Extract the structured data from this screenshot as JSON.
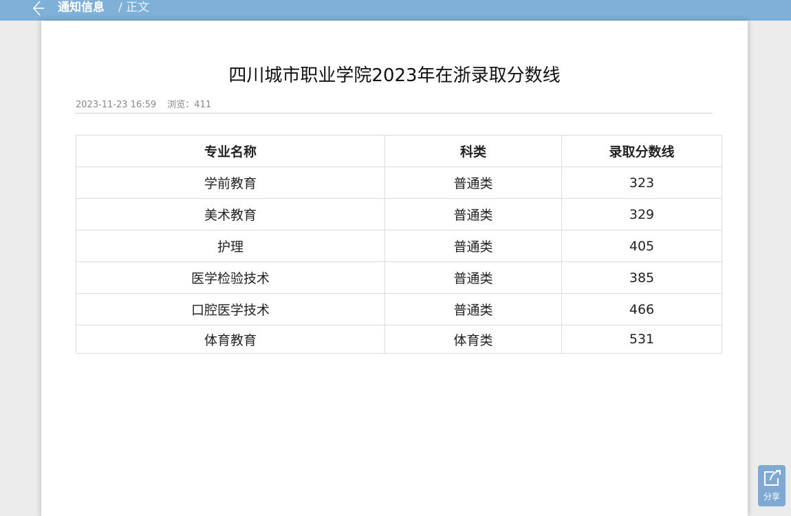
{
  "header": {
    "breadcrumb_main": "通知信息",
    "breadcrumb_current": "/ 正文",
    "bar_color": "#7fb0d8"
  },
  "article": {
    "title": "四川城市职业学院2023年在浙录取分数线",
    "date": "2023-11-23 16:59",
    "views": "浏览：411"
  },
  "table": {
    "headers": [
      "专业名称",
      "科类",
      "录取分数线"
    ],
    "rows": [
      [
        "学前教育",
        "普通类",
        "323"
      ],
      [
        "美术教育",
        "普通类",
        "329"
      ],
      [
        "护理",
        "普通类",
        "405"
      ],
      [
        "医学检验技术",
        "普通类",
        "385"
      ],
      [
        "口腔医学技术",
        "普通类",
        "466"
      ],
      [
        "体育教育",
        "体育类",
        "531"
      ]
    ]
  },
  "share": {
    "label": "分享",
    "icon": "share-icon"
  }
}
